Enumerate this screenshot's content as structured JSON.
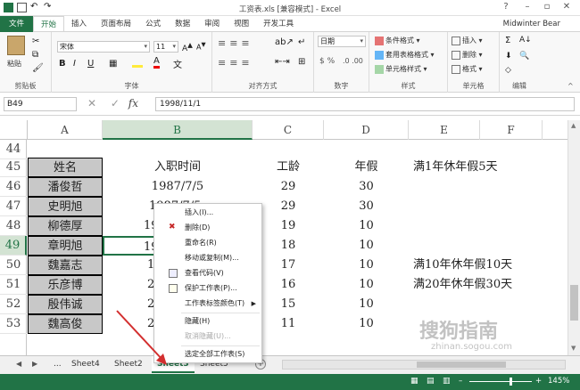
{
  "titlebar": {
    "title": "工资表.xls  [兼容模式] - Excel"
  },
  "ribbon_tabs": [
    "文件",
    "开始",
    "插入",
    "页面布局",
    "公式",
    "数据",
    "审阅",
    "视图",
    "开发工具"
  ],
  "user": "Midwinter Bear",
  "ribbon": {
    "clipboard": {
      "paste": "粘贴",
      "label": "剪贴板"
    },
    "font": {
      "name": "宋体",
      "size": "11",
      "label": "字体"
    },
    "align": {
      "label": "对齐方式"
    },
    "number": {
      "format": "日期",
      "label": "数字"
    },
    "styles": {
      "cond": "条件格式",
      "table": "套用表格格式",
      "cell": "单元格样式",
      "label": "样式"
    },
    "cells": {
      "insert": "插入",
      "delete": "删除",
      "format": "格式",
      "label": "单元格"
    },
    "editing": {
      "label": "编辑"
    }
  },
  "formula": {
    "namebox": "B49",
    "fx": "fx",
    "value": "1998/11/1"
  },
  "columns": [
    "A",
    "B",
    "C",
    "D",
    "E",
    "F"
  ],
  "rows": [
    "44",
    "45",
    "46",
    "47",
    "48",
    "49",
    "50",
    "51",
    "52",
    "53"
  ],
  "header": {
    "name": "姓名",
    "date": "入职时间",
    "age": "工龄",
    "leave": "年假",
    "rule1": "满1年休年假5天"
  },
  "data": [
    {
      "name": "潘俊哲",
      "date": "1987/7/5",
      "age": "29",
      "leave": "30"
    },
    {
      "name": "史明旭",
      "date": "1987/7/5",
      "age": "29",
      "leave": "30"
    },
    {
      "name": "柳德厚",
      "date": "199",
      "age": "19",
      "leave": "10"
    },
    {
      "name": "章明旭",
      "date": "199",
      "age": "18",
      "leave": "10"
    },
    {
      "name": "魏嘉志",
      "date": "19",
      "age": "17",
      "leave": "10",
      "note": "满10年休年假10天"
    },
    {
      "name": "乐彦博",
      "date": "20",
      "age": "16",
      "leave": "10",
      "note": "满20年休年假30天"
    },
    {
      "name": "殷伟诚",
      "date": "20",
      "age": "15",
      "leave": "10"
    },
    {
      "name": "魏高俊",
      "date": "20",
      "age": "11",
      "leave": "10"
    }
  ],
  "context_menu": [
    "插入(I)...",
    "删除(D)",
    "重命名(R)",
    "移动或复制(M)...",
    "查看代码(V)",
    "保护工作表(P)...",
    "工作表标签颜色(T)",
    "隐藏(H)",
    "取消隐藏(U)...",
    "选定全部工作表(S)"
  ],
  "sheet_tabs": {
    "ellipsis": "...",
    "tabs": [
      "Sheet4",
      "Sheet2",
      "Sheet3",
      "Sheet5"
    ],
    "active": "Sheet3"
  },
  "status": {
    "zoom": "145%"
  },
  "watermark": {
    "text": "搜狗指南",
    "url": "zhinan.sogou.com"
  },
  "colors": {
    "accent": "#217346",
    "arrow": "#d32f2f"
  }
}
